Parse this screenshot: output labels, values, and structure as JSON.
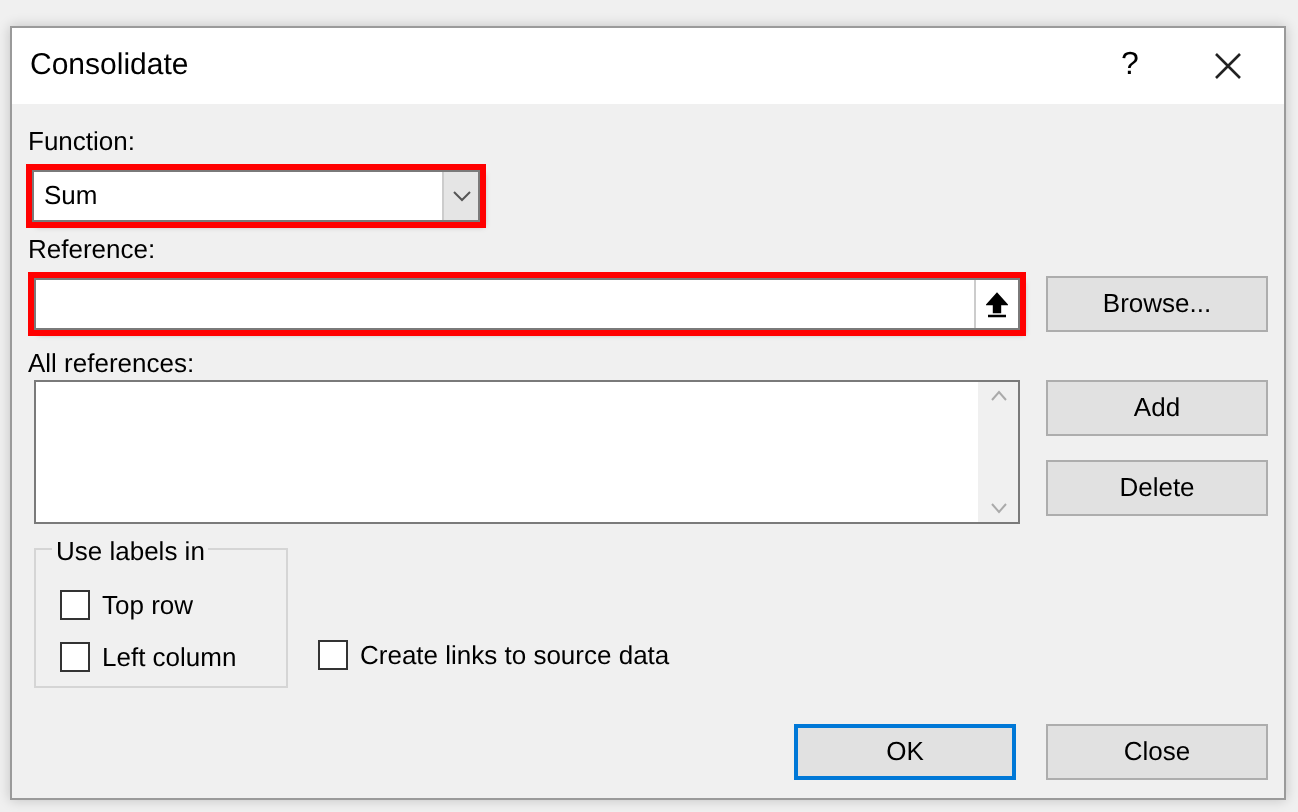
{
  "window": {
    "title": "Consolidate",
    "help": "?"
  },
  "function": {
    "label": "Function:",
    "value": "Sum",
    "highlighted": true
  },
  "reference": {
    "label": "Reference:",
    "highlighted": true
  },
  "all_references": {
    "label": "All references:"
  },
  "side_buttons": [
    {
      "label": "Browse..."
    },
    {
      "label": "Add"
    },
    {
      "label": "Delete"
    }
  ],
  "use_labels": {
    "title": "Use labels in",
    "options": [
      {
        "label": "Top row",
        "checked": false
      },
      {
        "label": "Left column",
        "checked": false
      }
    ]
  },
  "create_links": {
    "label": "Create links to source data",
    "checked": false
  },
  "buttons": [
    {
      "label": "OK",
      "default": true
    },
    {
      "label": "Close",
      "default": false
    }
  ]
}
